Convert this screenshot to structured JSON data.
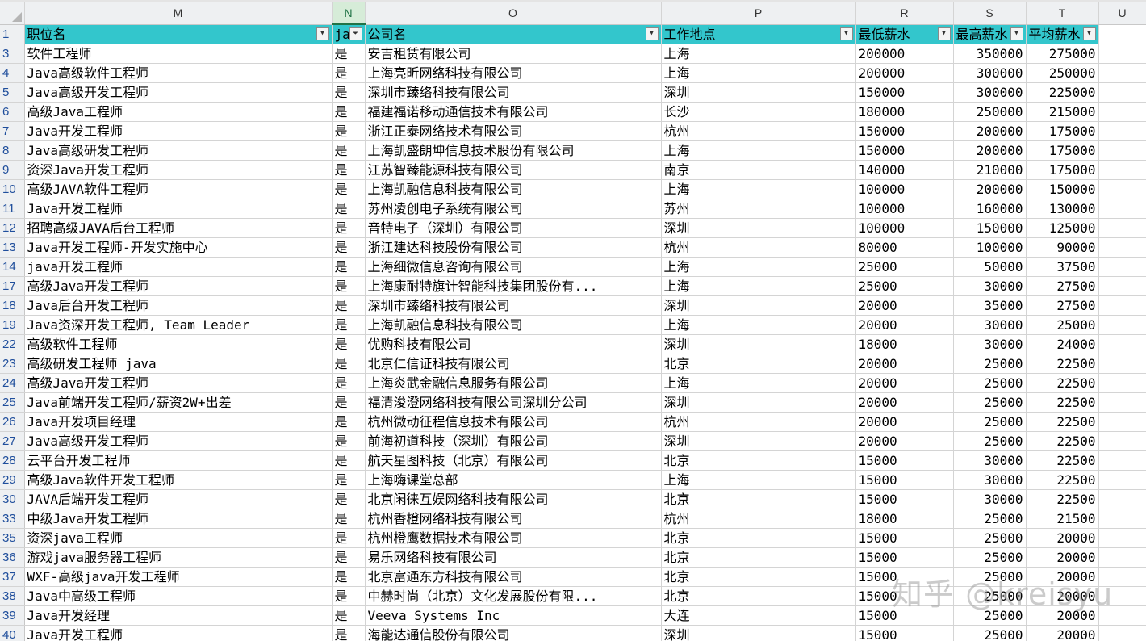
{
  "columns": [
    {
      "letter": "M"
    },
    {
      "letter": "N",
      "active": true
    },
    {
      "letter": "O"
    },
    {
      "letter": "P"
    },
    {
      "letter": "R"
    },
    {
      "letter": "S"
    },
    {
      "letter": "T"
    },
    {
      "letter": "U"
    }
  ],
  "header_row": {
    "row_number": "1",
    "cells": [
      "职位名",
      "ja",
      "公司名",
      "工作地点",
      "最低薪水",
      "最高薪水",
      "平均薪水"
    ]
  },
  "filter_icons": {
    "normal": "filter-dropdown-icon",
    "active": "filter-active-icon"
  },
  "rows": [
    {
      "n": "3",
      "c": [
        "软件工程师",
        "是",
        "安吉租赁有限公司",
        "上海",
        "200000",
        "350000",
        "275000"
      ]
    },
    {
      "n": "4",
      "c": [
        "Java高级软件工程师",
        "是",
        "上海亮昕网络科技有限公司",
        "上海",
        "200000",
        "300000",
        "250000"
      ]
    },
    {
      "n": "5",
      "c": [
        "Java高级开发工程师",
        "是",
        "深圳市臻络科技有限公司",
        "深圳",
        "150000",
        "300000",
        "225000"
      ]
    },
    {
      "n": "6",
      "c": [
        "高级Java工程师",
        "是",
        "福建福诺移动通信技术有限公司",
        "长沙",
        "180000",
        "250000",
        "215000"
      ]
    },
    {
      "n": "7",
      "c": [
        "Java开发工程师",
        "是",
        "浙江正泰网络技术有限公司",
        "杭州",
        "150000",
        "200000",
        "175000"
      ]
    },
    {
      "n": "8",
      "c": [
        "Java高级研发工程师",
        "是",
        "上海凯盛朗坤信息技术股份有限公司",
        "上海",
        "150000",
        "200000",
        "175000"
      ]
    },
    {
      "n": "9",
      "c": [
        "资深Java开发工程师",
        "是",
        "江苏智臻能源科技有限公司",
        "南京",
        "140000",
        "210000",
        "175000"
      ]
    },
    {
      "n": "10",
      "c": [
        "高级JAVA软件工程师",
        "是",
        "上海凯融信息科技有限公司",
        "上海",
        "100000",
        "200000",
        "150000"
      ]
    },
    {
      "n": "11",
      "c": [
        "Java开发工程师",
        "是",
        "苏州凌创电子系统有限公司",
        "苏州",
        "100000",
        "160000",
        "130000"
      ]
    },
    {
      "n": "12",
      "c": [
        "招聘高级JAVA后台工程师",
        "是",
        "音特电子（深圳）有限公司",
        "深圳",
        "100000",
        "150000",
        "125000"
      ]
    },
    {
      "n": "13",
      "c": [
        "Java开发工程师-开发实施中心",
        "是",
        "浙江建达科技股份有限公司",
        "杭州",
        "80000",
        "100000",
        "90000"
      ]
    },
    {
      "n": "14",
      "c": [
        "java开发工程师",
        "是",
        "上海细微信息咨询有限公司",
        "上海",
        "25000",
        "50000",
        "37500"
      ]
    },
    {
      "n": "17",
      "c": [
        "高级Java开发工程师",
        "是",
        "上海康耐特旗计智能科技集团股份有...",
        "上海",
        "25000",
        "30000",
        "27500"
      ]
    },
    {
      "n": "18",
      "c": [
        "Java后台开发工程师",
        "是",
        "深圳市臻络科技有限公司",
        "深圳",
        "20000",
        "35000",
        "27500"
      ]
    },
    {
      "n": "19",
      "c": [
        "Java资深开发工程师, Team Leader",
        "是",
        "上海凯融信息科技有限公司",
        "上海",
        "20000",
        "30000",
        "25000"
      ]
    },
    {
      "n": "22",
      "c": [
        "高级软件工程师",
        "是",
        "优购科技有限公司",
        "深圳",
        "18000",
        "30000",
        "24000"
      ]
    },
    {
      "n": "23",
      "c": [
        "高级研发工程师 java",
        "是",
        "北京仁信证科技有限公司",
        "北京",
        "20000",
        "25000",
        "22500"
      ]
    },
    {
      "n": "24",
      "c": [
        "高级Java开发工程师",
        "是",
        "上海炎武金融信息服务有限公司",
        "上海",
        "20000",
        "25000",
        "22500"
      ]
    },
    {
      "n": "25",
      "c": [
        "Java前端开发工程师/薪资2W+出差",
        "是",
        "福清浚澄网络科技有限公司深圳分公司",
        "深圳",
        "20000",
        "25000",
        "22500"
      ]
    },
    {
      "n": "26",
      "c": [
        "Java开发项目经理",
        "是",
        "杭州微动征程信息技术有限公司",
        "杭州",
        "20000",
        "25000",
        "22500"
      ]
    },
    {
      "n": "27",
      "c": [
        "Java高级开发工程师",
        "是",
        "前海初道科技（深圳）有限公司",
        "深圳",
        "20000",
        "25000",
        "22500"
      ]
    },
    {
      "n": "28",
      "c": [
        "云平台开发工程师",
        "是",
        "航天星图科技（北京）有限公司",
        "北京",
        "15000",
        "30000",
        "22500"
      ]
    },
    {
      "n": "29",
      "c": [
        "高级Java软件开发工程师",
        "是",
        "上海嗨课堂总部",
        "上海",
        "15000",
        "30000",
        "22500"
      ]
    },
    {
      "n": "30",
      "c": [
        "JAVA后端开发工程师",
        "是",
        "北京闲徕互娱网络科技有限公司",
        "北京",
        "15000",
        "30000",
        "22500"
      ]
    },
    {
      "n": "33",
      "c": [
        "中级Java开发工程师",
        "是",
        "杭州香橙网络科技有限公司",
        "杭州",
        "18000",
        "25000",
        "21500"
      ]
    },
    {
      "n": "35",
      "c": [
        "资深java工程师",
        "是",
        "杭州橙鹰数据技术有限公司",
        "北京",
        "15000",
        "25000",
        "20000"
      ]
    },
    {
      "n": "36",
      "c": [
        "游戏java服务器工程师",
        "是",
        "易乐网络科技有限公司",
        "北京",
        "15000",
        "25000",
        "20000"
      ]
    },
    {
      "n": "37",
      "c": [
        "WXF-高级java开发工程师",
        "是",
        "北京富通东方科技有限公司",
        "北京",
        "15000",
        "25000",
        "20000"
      ]
    },
    {
      "n": "38",
      "c": [
        "Java中高级工程师",
        "是",
        "中赫时尚（北京）文化发展股份有限...",
        "北京",
        "15000",
        "25000",
        "20000"
      ]
    },
    {
      "n": "39",
      "c": [
        "Java开发经理",
        "是",
        "Veeva Systems Inc",
        "大连",
        "15000",
        "25000",
        "20000"
      ]
    },
    {
      "n": "40",
      "c": [
        "Java开发工程师",
        "是",
        "海能达通信股份有限公司",
        "深圳",
        "15000",
        "25000",
        "20000"
      ]
    }
  ],
  "watermark": "知乎 @kreisyu"
}
